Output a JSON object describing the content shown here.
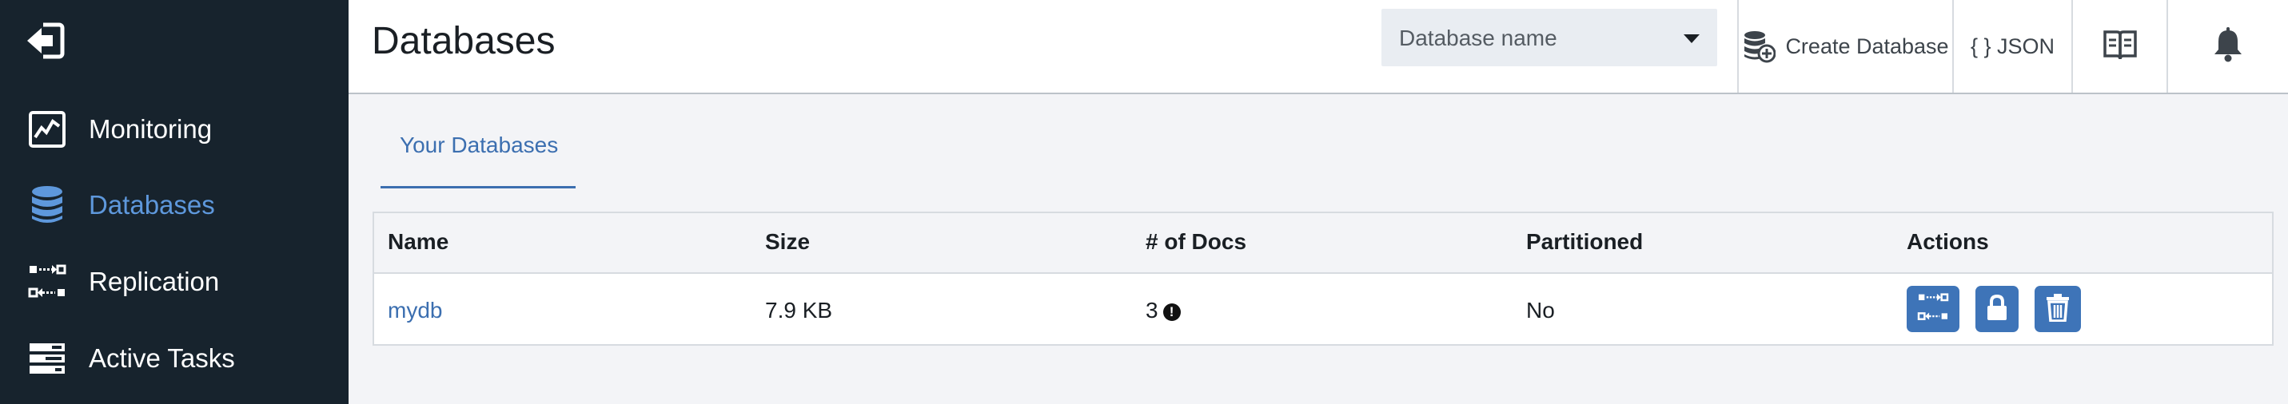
{
  "sidebar": {
    "items": [
      {
        "label": "Monitoring",
        "icon": "monitoring-icon"
      },
      {
        "label": "Databases",
        "icon": "databases-icon",
        "active": true
      },
      {
        "label": "Replication",
        "icon": "replication-icon"
      },
      {
        "label": "Active Tasks",
        "icon": "active-tasks-icon"
      }
    ]
  },
  "header": {
    "title": "Databases",
    "db_select": {
      "placeholder": "Database name"
    },
    "create_database_label": "Create Database",
    "json_label": "{ } JSON"
  },
  "tabs": [
    {
      "label": "Your Databases",
      "active": true
    }
  ],
  "table": {
    "columns": [
      "Name",
      "Size",
      "# of Docs",
      "Partitioned",
      "Actions"
    ],
    "rows": [
      {
        "name": "mydb",
        "size": "7.9 KB",
        "docs": "3",
        "partitioned": "No"
      }
    ]
  },
  "colors": {
    "sidebar_bg": "#17232d",
    "active_accent": "#5e98dc",
    "link": "#3c6fb0",
    "action_button": "#3e74b8"
  }
}
